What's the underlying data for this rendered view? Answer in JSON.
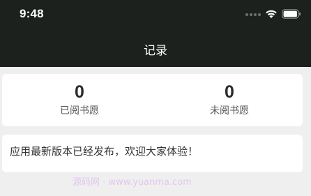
{
  "status_bar": {
    "time": "9:48",
    "icons": [
      "cellular-dots-icon",
      "wifi-icon",
      "battery-icon"
    ]
  },
  "nav_bar": {
    "title": "记录",
    "background": "#1c211d"
  },
  "stats": [
    {
      "value": "0",
      "label": "已阅书愿"
    },
    {
      "value": "0",
      "label": "未阅书愿"
    }
  ],
  "notice": {
    "text": "应用最新版本已经发布，欢迎大家体验！"
  },
  "watermark": {
    "text": "源码网 · www.yuanma.com"
  },
  "colors": {
    "header": "#1c211d",
    "page_background": "#efeff0",
    "card": "#ffffff"
  }
}
